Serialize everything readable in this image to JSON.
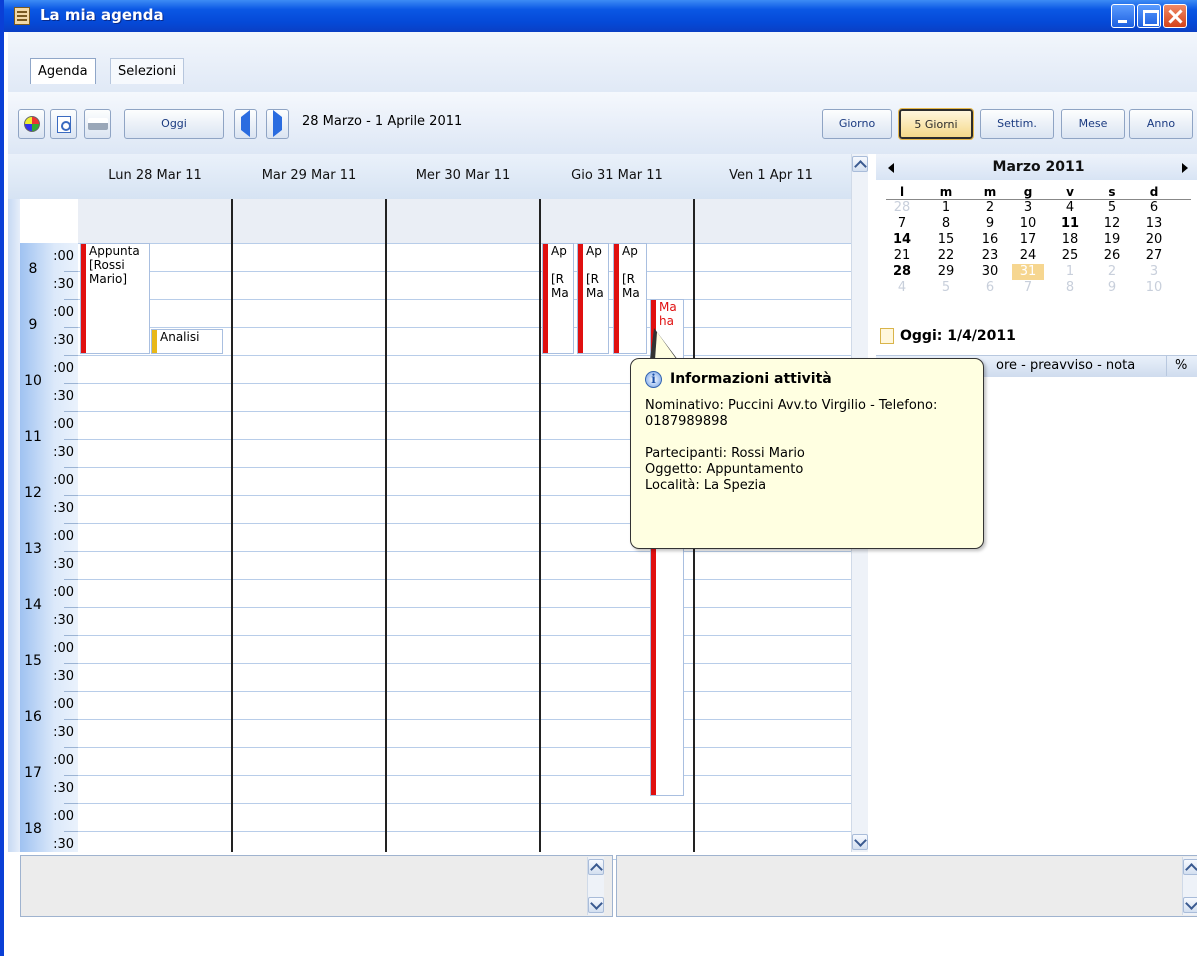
{
  "window": {
    "title": "La mia agenda"
  },
  "tabs": [
    {
      "label": "Agenda"
    },
    {
      "label": "Selezioni"
    }
  ],
  "toolbar": {
    "today_label": "Oggi",
    "date_range": "28 Marzo - 1 Aprile 2011",
    "views": [
      {
        "label": "Giorno"
      },
      {
        "label": "5 Giorni",
        "selected": true
      },
      {
        "label": "Settim."
      },
      {
        "label": "Mese"
      },
      {
        "label": "Anno"
      }
    ]
  },
  "days": [
    "Lun 28 Mar 11",
    "Mar 29 Mar 11",
    "Mer 30 Mar 11",
    "Gio 31 Mar 11",
    "Ven 1 Apr 11"
  ],
  "hours": [
    "8",
    "9",
    "10",
    "11",
    "12",
    "13",
    "14",
    "15",
    "16",
    "17",
    "18"
  ],
  "minutes": {
    "full": ":00",
    "half": ":30"
  },
  "appointments": [
    {
      "text": "Appunta\n[Rossi\nMario]"
    },
    {
      "text": "Analisi"
    },
    {
      "text": "Ap\n\n[R\nMa"
    },
    {
      "text": "Ap\n\n[R\nMa"
    },
    {
      "text": "Ap\n\n[R\nMa"
    },
    {
      "text": "Ma\nha"
    }
  ],
  "mini_calendar": {
    "month": "Marzo 2011",
    "weekdays": [
      "l",
      "m",
      "m",
      "g",
      "v",
      "s",
      "d"
    ],
    "weeks": [
      [
        "28",
        "1",
        "2",
        "3",
        "4",
        "5",
        "6"
      ],
      [
        "7",
        "8",
        "9",
        "10",
        "11",
        "12",
        "13"
      ],
      [
        "14",
        "15",
        "16",
        "17",
        "18",
        "19",
        "20"
      ],
      [
        "21",
        "22",
        "23",
        "24",
        "25",
        "26",
        "27"
      ],
      [
        "28",
        "29",
        "30",
        "31",
        "1",
        "2",
        "3"
      ],
      [
        "4",
        "5",
        "6",
        "7",
        "8",
        "9",
        "10"
      ]
    ],
    "today_text": "Oggi: 1/4/2011"
  },
  "list_header": {
    "col1": "ore - preavviso - nota",
    "col2": "%"
  },
  "tooltip": {
    "title": "Informazioni attività",
    "body": "Nominativo: Puccini Avv.to Virgilio - Telefono:\n0187989898\n\nPartecipanti: Rossi Mario\nOggetto: Appuntamento\nLocalità: La Spezia"
  },
  "colors": {
    "accent": "#0a57e4",
    "appointment_bar": "#e01010",
    "selected_day": "#f6d690"
  }
}
